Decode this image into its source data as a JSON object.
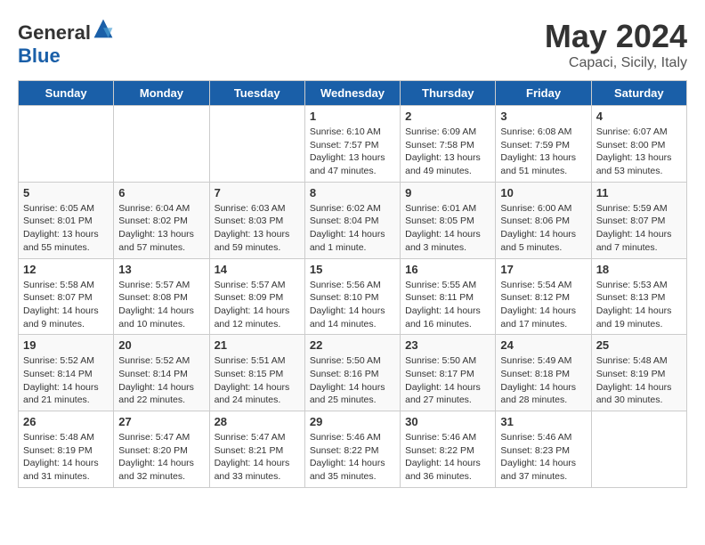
{
  "header": {
    "logo_general": "General",
    "logo_blue": "Blue",
    "month": "May 2024",
    "location": "Capaci, Sicily, Italy"
  },
  "weekdays": [
    "Sunday",
    "Monday",
    "Tuesday",
    "Wednesday",
    "Thursday",
    "Friday",
    "Saturday"
  ],
  "weeks": [
    [
      {
        "day": "",
        "sunrise": "",
        "sunset": "",
        "daylight": ""
      },
      {
        "day": "",
        "sunrise": "",
        "sunset": "",
        "daylight": ""
      },
      {
        "day": "",
        "sunrise": "",
        "sunset": "",
        "daylight": ""
      },
      {
        "day": "1",
        "sunrise": "Sunrise: 6:10 AM",
        "sunset": "Sunset: 7:57 PM",
        "daylight": "Daylight: 13 hours and 47 minutes."
      },
      {
        "day": "2",
        "sunrise": "Sunrise: 6:09 AM",
        "sunset": "Sunset: 7:58 PM",
        "daylight": "Daylight: 13 hours and 49 minutes."
      },
      {
        "day": "3",
        "sunrise": "Sunrise: 6:08 AM",
        "sunset": "Sunset: 7:59 PM",
        "daylight": "Daylight: 13 hours and 51 minutes."
      },
      {
        "day": "4",
        "sunrise": "Sunrise: 6:07 AM",
        "sunset": "Sunset: 8:00 PM",
        "daylight": "Daylight: 13 hours and 53 minutes."
      }
    ],
    [
      {
        "day": "5",
        "sunrise": "Sunrise: 6:05 AM",
        "sunset": "Sunset: 8:01 PM",
        "daylight": "Daylight: 13 hours and 55 minutes."
      },
      {
        "day": "6",
        "sunrise": "Sunrise: 6:04 AM",
        "sunset": "Sunset: 8:02 PM",
        "daylight": "Daylight: 13 hours and 57 minutes."
      },
      {
        "day": "7",
        "sunrise": "Sunrise: 6:03 AM",
        "sunset": "Sunset: 8:03 PM",
        "daylight": "Daylight: 13 hours and 59 minutes."
      },
      {
        "day": "8",
        "sunrise": "Sunrise: 6:02 AM",
        "sunset": "Sunset: 8:04 PM",
        "daylight": "Daylight: 14 hours and 1 minute."
      },
      {
        "day": "9",
        "sunrise": "Sunrise: 6:01 AM",
        "sunset": "Sunset: 8:05 PM",
        "daylight": "Daylight: 14 hours and 3 minutes."
      },
      {
        "day": "10",
        "sunrise": "Sunrise: 6:00 AM",
        "sunset": "Sunset: 8:06 PM",
        "daylight": "Daylight: 14 hours and 5 minutes."
      },
      {
        "day": "11",
        "sunrise": "Sunrise: 5:59 AM",
        "sunset": "Sunset: 8:07 PM",
        "daylight": "Daylight: 14 hours and 7 minutes."
      }
    ],
    [
      {
        "day": "12",
        "sunrise": "Sunrise: 5:58 AM",
        "sunset": "Sunset: 8:07 PM",
        "daylight": "Daylight: 14 hours and 9 minutes."
      },
      {
        "day": "13",
        "sunrise": "Sunrise: 5:57 AM",
        "sunset": "Sunset: 8:08 PM",
        "daylight": "Daylight: 14 hours and 10 minutes."
      },
      {
        "day": "14",
        "sunrise": "Sunrise: 5:57 AM",
        "sunset": "Sunset: 8:09 PM",
        "daylight": "Daylight: 14 hours and 12 minutes."
      },
      {
        "day": "15",
        "sunrise": "Sunrise: 5:56 AM",
        "sunset": "Sunset: 8:10 PM",
        "daylight": "Daylight: 14 hours and 14 minutes."
      },
      {
        "day": "16",
        "sunrise": "Sunrise: 5:55 AM",
        "sunset": "Sunset: 8:11 PM",
        "daylight": "Daylight: 14 hours and 16 minutes."
      },
      {
        "day": "17",
        "sunrise": "Sunrise: 5:54 AM",
        "sunset": "Sunset: 8:12 PM",
        "daylight": "Daylight: 14 hours and 17 minutes."
      },
      {
        "day": "18",
        "sunrise": "Sunrise: 5:53 AM",
        "sunset": "Sunset: 8:13 PM",
        "daylight": "Daylight: 14 hours and 19 minutes."
      }
    ],
    [
      {
        "day": "19",
        "sunrise": "Sunrise: 5:52 AM",
        "sunset": "Sunset: 8:14 PM",
        "daylight": "Daylight: 14 hours and 21 minutes."
      },
      {
        "day": "20",
        "sunrise": "Sunrise: 5:52 AM",
        "sunset": "Sunset: 8:14 PM",
        "daylight": "Daylight: 14 hours and 22 minutes."
      },
      {
        "day": "21",
        "sunrise": "Sunrise: 5:51 AM",
        "sunset": "Sunset: 8:15 PM",
        "daylight": "Daylight: 14 hours and 24 minutes."
      },
      {
        "day": "22",
        "sunrise": "Sunrise: 5:50 AM",
        "sunset": "Sunset: 8:16 PM",
        "daylight": "Daylight: 14 hours and 25 minutes."
      },
      {
        "day": "23",
        "sunrise": "Sunrise: 5:50 AM",
        "sunset": "Sunset: 8:17 PM",
        "daylight": "Daylight: 14 hours and 27 minutes."
      },
      {
        "day": "24",
        "sunrise": "Sunrise: 5:49 AM",
        "sunset": "Sunset: 8:18 PM",
        "daylight": "Daylight: 14 hours and 28 minutes."
      },
      {
        "day": "25",
        "sunrise": "Sunrise: 5:48 AM",
        "sunset": "Sunset: 8:19 PM",
        "daylight": "Daylight: 14 hours and 30 minutes."
      }
    ],
    [
      {
        "day": "26",
        "sunrise": "Sunrise: 5:48 AM",
        "sunset": "Sunset: 8:19 PM",
        "daylight": "Daylight: 14 hours and 31 minutes."
      },
      {
        "day": "27",
        "sunrise": "Sunrise: 5:47 AM",
        "sunset": "Sunset: 8:20 PM",
        "daylight": "Daylight: 14 hours and 32 minutes."
      },
      {
        "day": "28",
        "sunrise": "Sunrise: 5:47 AM",
        "sunset": "Sunset: 8:21 PM",
        "daylight": "Daylight: 14 hours and 33 minutes."
      },
      {
        "day": "29",
        "sunrise": "Sunrise: 5:46 AM",
        "sunset": "Sunset: 8:22 PM",
        "daylight": "Daylight: 14 hours and 35 minutes."
      },
      {
        "day": "30",
        "sunrise": "Sunrise: 5:46 AM",
        "sunset": "Sunset: 8:22 PM",
        "daylight": "Daylight: 14 hours and 36 minutes."
      },
      {
        "day": "31",
        "sunrise": "Sunrise: 5:46 AM",
        "sunset": "Sunset: 8:23 PM",
        "daylight": "Daylight: 14 hours and 37 minutes."
      },
      {
        "day": "",
        "sunrise": "",
        "sunset": "",
        "daylight": ""
      }
    ]
  ]
}
